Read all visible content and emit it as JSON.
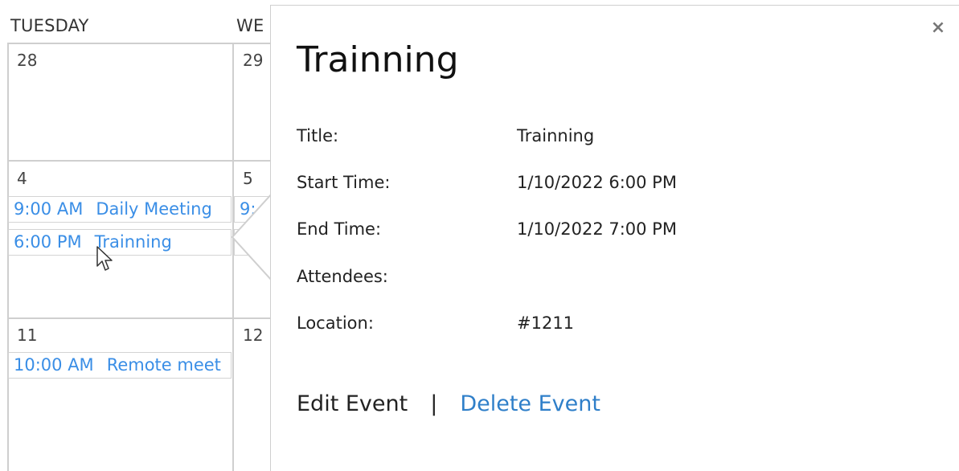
{
  "calendar": {
    "headers": {
      "tuesday": "TUESDAY",
      "wednesday": "WE"
    },
    "days": {
      "d28": "28",
      "d29": "29",
      "d4": "4",
      "d5": "5",
      "d11": "11",
      "d12": "12"
    },
    "events": {
      "daily_meeting": {
        "time": "9:00 AM",
        "title": "Daily Meeting"
      },
      "trainning": {
        "time": "6:00 PM",
        "title": "Trainning"
      },
      "remote_meeting": {
        "time": "10:00 AM",
        "title": "Remote meet"
      },
      "wed_partial": {
        "time": "9:"
      }
    }
  },
  "popup": {
    "title": "Trainning",
    "close_symbol": "×",
    "fields": {
      "title": {
        "label": "Title:",
        "value": "Trainning"
      },
      "start": {
        "label": "Start Time:",
        "value": "1/10/2022 6:00 PM"
      },
      "end": {
        "label": "End Time:",
        "value": "1/10/2022 7:00 PM"
      },
      "attendees": {
        "label": "Attendees:",
        "value": ""
      },
      "location": {
        "label": "Location:",
        "value": "#1211"
      }
    },
    "actions": {
      "edit": "Edit Event",
      "separator": "|",
      "delete": "Delete Event"
    }
  },
  "colors": {
    "event_link": "#3a8ee6",
    "delete_link": "#2f7fc9",
    "grid": "#cfcfcf"
  }
}
